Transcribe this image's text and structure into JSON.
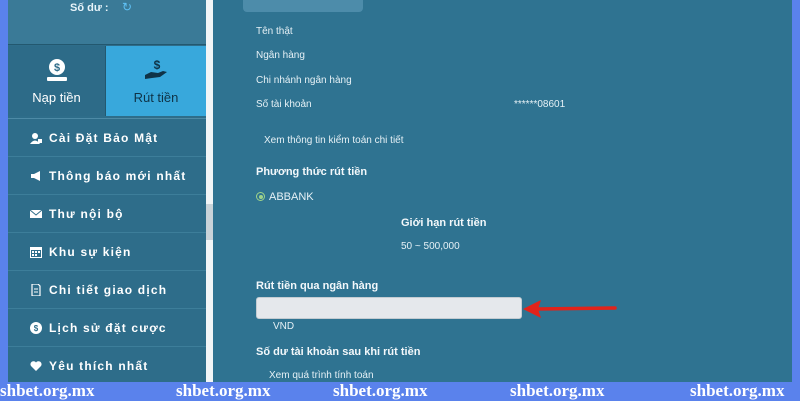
{
  "sidebar": {
    "balance_label": "Số dư :",
    "actions": [
      {
        "label": "Nạp tiền",
        "icon": "money-bag-icon"
      },
      {
        "label": "Rút tiền",
        "icon": "hand-money-icon"
      }
    ],
    "menu": [
      {
        "label": "Cài Đặt Bảo Mật",
        "icon": "user-lock-icon"
      },
      {
        "label": "Thông báo mới nhất",
        "icon": "megaphone-icon"
      },
      {
        "label": "Thư nội bộ",
        "icon": "envelope-icon"
      },
      {
        "label": "Khu sự kiện",
        "icon": "calendar-icon"
      },
      {
        "label": "Chi tiết giao dịch",
        "icon": "document-icon"
      },
      {
        "label": "Lịch sử đặt cược",
        "icon": "coin-icon"
      },
      {
        "label": "Yêu thích nhất",
        "icon": "heart-icon"
      }
    ]
  },
  "account": {
    "real_name_label": "Tên thật",
    "bank_label": "Ngân hàng",
    "branch_label": "Chi nhánh ngân hàng",
    "account_number_label": "Số tài khoản",
    "account_number_value": "******08601",
    "audit_link": "Xem thông tin kiểm toán chi tiết"
  },
  "withdraw": {
    "method_title": "Phương thức rút tiền",
    "method_option": "ABBANK",
    "limit_title": "Giới hạn rút tiền",
    "limit_value": "50 ~ 500,000",
    "bank_section_title": "Rút tiền qua ngân hàng",
    "amount_value": "",
    "currency": "VND",
    "balance_after_title": "Số dư tài khoản sau khi rút tiền",
    "calc_link": "Xem quá trình tính toán"
  },
  "watermark": "shbet.org.mx",
  "colors": {
    "background": "#5a82ec",
    "panel": "#2f7391",
    "active_tab": "#38a8dc",
    "arrow": "#e2231a"
  }
}
